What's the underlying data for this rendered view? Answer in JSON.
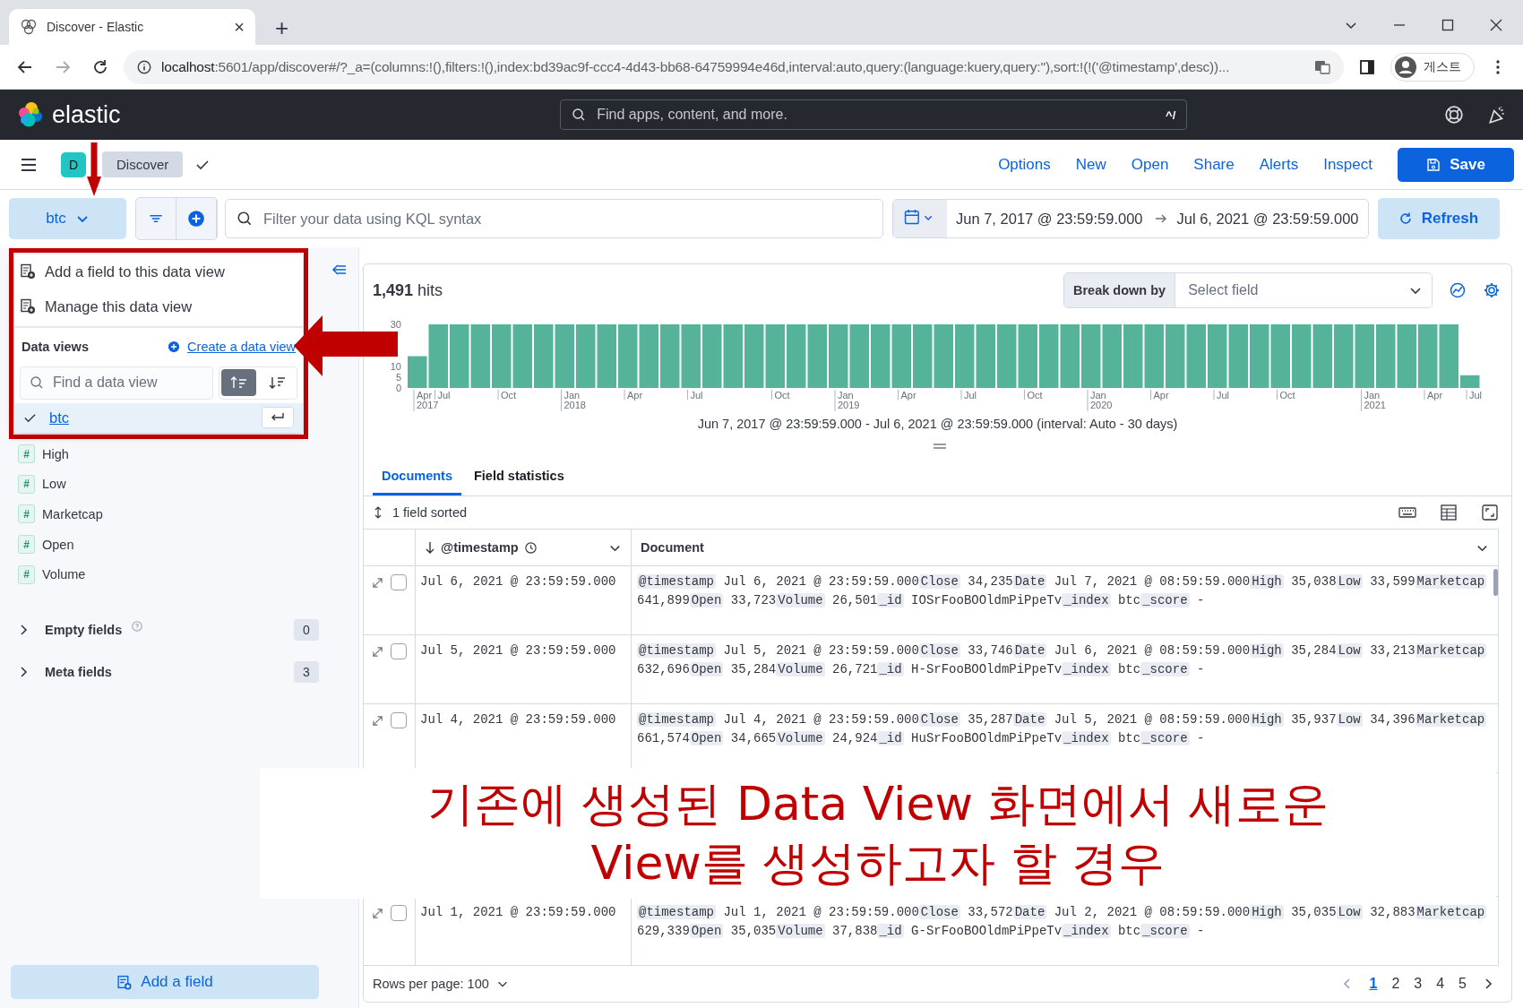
{
  "browser": {
    "tab_title": "Discover - Elastic",
    "tab_close": "×",
    "new_tab": "+",
    "url_host": "localhost",
    "url_rest": ":5601/app/discover#/?_a=(columns:!(),filters:!(),index:bd39ac9f-ccc4-4d43-bb68-64759994e46d,interval:auto,query:(language:kuery,query:''),sort:!(!('@timestamp',desc))...",
    "profile": "게스트"
  },
  "header": {
    "brand": "elastic",
    "search": {
      "placeholder": "Find apps, content, and more.",
      "shortcut": "^/"
    }
  },
  "app_bar": {
    "avatar": "D",
    "breadcrumb": "Discover",
    "menu": [
      "Options",
      "New",
      "Open",
      "Share",
      "Alerts",
      "Inspect"
    ],
    "save": "Save"
  },
  "query_bar": {
    "data_view": "btc",
    "search": {
      "placeholder": "Filter your data using KQL syntax"
    },
    "start": "Jun 7, 2017 @ 23:59:59.000",
    "end": "Jul 6, 2021 @ 23:59:59.000",
    "refresh": "Refresh"
  },
  "data_view_menu": {
    "actions": [
      "Add a field to this data view",
      "Manage this data view"
    ],
    "section_title": "Data views",
    "create_link": "Create a data view",
    "search": {
      "placeholder": "Find a data view"
    },
    "sort_options": [
      {
        "kind": "ascending",
        "selected": true
      },
      {
        "kind": "descending",
        "selected": false
      }
    ],
    "views": [
      {
        "name": "btc",
        "selected": true
      }
    ]
  },
  "sidebar": {
    "fields": [
      {
        "name": "High",
        "type": "#"
      },
      {
        "name": "Low",
        "type": "#"
      },
      {
        "name": "Marketcap",
        "type": "#"
      },
      {
        "name": "Open",
        "type": "#"
      },
      {
        "name": "Volume",
        "type": "#"
      }
    ],
    "groups": [
      {
        "label": "Empty fields",
        "count": "0",
        "info": true,
        "expanded": false
      },
      {
        "label": "Meta fields",
        "count": "3",
        "info": false,
        "expanded": false
      }
    ],
    "add_field": "Add a field"
  },
  "results": {
    "hits_count": "1,491",
    "hits_label": "hits",
    "breakdown": {
      "label": "Break down by",
      "placeholder": "Select field"
    },
    "chart_data": {
      "type": "bar",
      "categories": [
        "Apr 2017",
        "Jul",
        null,
        null,
        "Oct",
        null,
        null,
        "Jan 2018",
        null,
        null,
        "Apr",
        null,
        null,
        "Jul",
        null,
        null,
        null,
        "Oct",
        null,
        null,
        "Jan 2019",
        null,
        null,
        "Apr",
        null,
        null,
        "Jul",
        null,
        null,
        "Oct",
        null,
        null,
        "Jan 2020",
        null,
        null,
        "Apr",
        null,
        null,
        "Jul",
        null,
        null,
        "Oct",
        null,
        null,
        null,
        "Jan 2021",
        null,
        null,
        "Apr",
        null,
        "Jul"
      ],
      "values": [
        15,
        30,
        30,
        30,
        30,
        30,
        30,
        30,
        30,
        30,
        30,
        30,
        30,
        30,
        30,
        30,
        30,
        30,
        30,
        30,
        30,
        30,
        30,
        30,
        30,
        30,
        30,
        30,
        30,
        30,
        30,
        30,
        30,
        30,
        30,
        30,
        30,
        30,
        30,
        30,
        30,
        30,
        30,
        30,
        30,
        30,
        30,
        30,
        30,
        30,
        6
      ],
      "ylim": [
        0,
        30
      ],
      "yticks": [
        0,
        5,
        10,
        30
      ]
    },
    "interval_caption": "Jun 7, 2017 @ 23:59:59.000 - Jul 6, 2021 @ 23:59:59.000 (interval: Auto - 30 days)",
    "tabs": [
      {
        "label": "Documents",
        "selected": true
      },
      {
        "label": "Field statistics",
        "selected": false
      }
    ],
    "sort_summary": "1 field sorted",
    "columns": [
      "@timestamp",
      "Document"
    ],
    "rows": [
      {
        "checked": false,
        "timestamp": "Jul 6, 2021 @ 23:59:59.000",
        "fields": [
          {
            "key": "@timestamp",
            "value": "Jul 6, 2021 @ 23:59:59.000"
          },
          {
            "key": "Close",
            "value": "34,235"
          },
          {
            "key": "Date",
            "value": "Jul 7, 2021 @ 08:59:59.000"
          },
          {
            "key": "High",
            "value": "35,038"
          },
          {
            "key": "Low",
            "value": "33,599"
          },
          {
            "key": "Marketcap",
            "value": "641,899"
          },
          {
            "key": "Open",
            "value": "33,723"
          },
          {
            "key": "Volume",
            "value": "26,501"
          },
          {
            "key": "_id",
            "value": "IOSrFooBOOldmPiPpeTv"
          },
          {
            "key": "_index",
            "value": "btc"
          },
          {
            "key": "_score",
            "value": "-"
          }
        ]
      },
      {
        "checked": false,
        "timestamp": "Jul 5, 2021 @ 23:59:59.000",
        "fields": [
          {
            "key": "@timestamp",
            "value": "Jul 5, 2021 @ 23:59:59.000"
          },
          {
            "key": "Close",
            "value": "33,746"
          },
          {
            "key": "Date",
            "value": "Jul 6, 2021 @ 08:59:59.000"
          },
          {
            "key": "High",
            "value": "35,284"
          },
          {
            "key": "Low",
            "value": "33,213"
          },
          {
            "key": "Marketcap",
            "value": "632,696"
          },
          {
            "key": "Open",
            "value": "35,284"
          },
          {
            "key": "Volume",
            "value": "26,721"
          },
          {
            "key": "_id",
            "value": "H-SrFooBOOldmPiPpeTv"
          },
          {
            "key": "_index",
            "value": "btc"
          },
          {
            "key": "_score",
            "value": "-"
          }
        ]
      },
      {
        "checked": false,
        "timestamp": "Jul 4, 2021 @ 23:59:59.000",
        "fields": [
          {
            "key": "@timestamp",
            "value": "Jul 4, 2021 @ 23:59:59.000"
          },
          {
            "key": "Close",
            "value": "35,287"
          },
          {
            "key": "Date",
            "value": "Jul 5, 2021 @ 08:59:59.000"
          },
          {
            "key": "High",
            "value": "35,937"
          },
          {
            "key": "Low",
            "value": "34,396"
          },
          {
            "key": "Marketcap",
            "value": "661,574"
          },
          {
            "key": "Open",
            "value": "34,665"
          },
          {
            "key": "Volume",
            "value": "24,924"
          },
          {
            "key": "_id",
            "value": "HuSrFooBOOldmPiPpeTv"
          },
          {
            "key": "_index",
            "value": "btc"
          },
          {
            "key": "_score",
            "value": "-"
          }
        ]
      },
      {
        "checked": false,
        "timestamp": "Jul 1, 2021 @ 23:59:59.000",
        "fields": [
          {
            "key": "@timestamp",
            "value": "Jul 1, 2021 @ 23:59:59.000"
          },
          {
            "key": "Close",
            "value": "33,572"
          },
          {
            "key": "Date",
            "value": "Jul 2, 2021 @ 08:59:59.000"
          },
          {
            "key": "High",
            "value": "35,035"
          },
          {
            "key": "Low",
            "value": "32,883"
          },
          {
            "key": "Marketcap",
            "value": "629,339"
          },
          {
            "key": "Open",
            "value": "35,035"
          },
          {
            "key": "Volume",
            "value": "37,838"
          },
          {
            "key": "_id",
            "value": "G-SrFooBOOldmPiPpeTv"
          },
          {
            "key": "_index",
            "value": "btc"
          },
          {
            "key": "_score",
            "value": "-"
          }
        ]
      }
    ],
    "rows_per_page": "Rows per page: 100",
    "pages": [
      {
        "label": "1",
        "selected": true
      },
      {
        "label": "2",
        "selected": false
      },
      {
        "label": "3",
        "selected": false
      },
      {
        "label": "4",
        "selected": false
      },
      {
        "label": "5",
        "selected": false
      }
    ]
  },
  "annotation": {
    "caption": [
      "기존에 생성된 Data View 화면에서 새로운",
      "View를 생성하고자 할 경우"
    ]
  }
}
